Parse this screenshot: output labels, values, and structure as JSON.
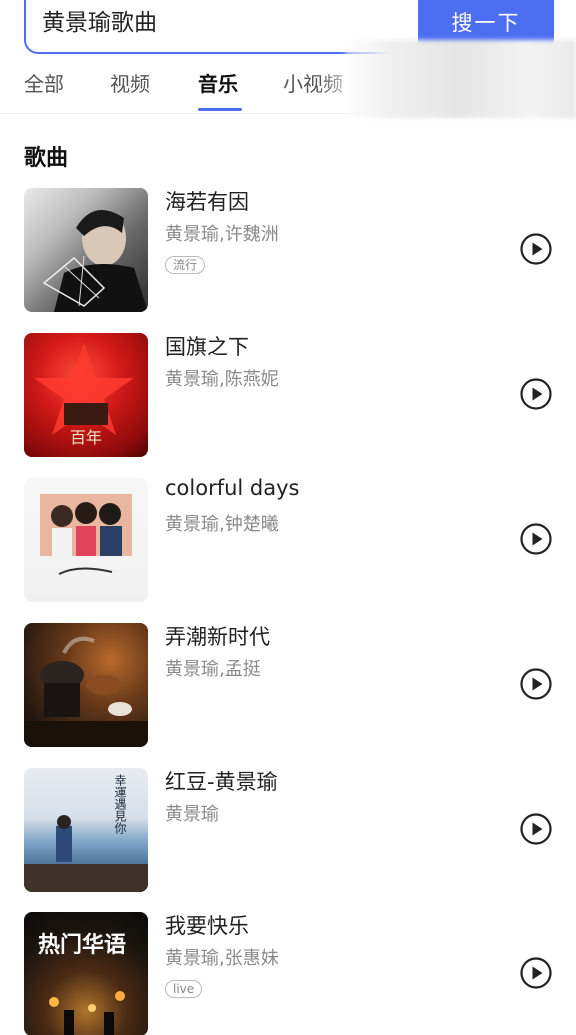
{
  "search": {
    "query": "黄景瑜歌曲",
    "button_label": "搜一下"
  },
  "tabs": [
    {
      "label": "全部",
      "active": false
    },
    {
      "label": "视频",
      "active": false
    },
    {
      "label": "音乐",
      "active": true
    },
    {
      "label": "小视频",
      "active": false
    }
  ],
  "section": {
    "title": "歌曲"
  },
  "songs": [
    {
      "title": "海若有因",
      "artist": "黄景瑜,许魏洲",
      "tag": "流行"
    },
    {
      "title": "国旗之下",
      "artist": "黄景瑜,陈燕妮",
      "tag": "",
      "cover_text": "百年"
    },
    {
      "title": "colorful days",
      "artist": "黄景瑜,钟楚曦",
      "tag": ""
    },
    {
      "title": "弄潮新时代",
      "artist": "黄景瑜,孟挺",
      "tag": ""
    },
    {
      "title": "红豆-黄景瑜",
      "artist": "黄景瑜",
      "tag": "",
      "cover_text": "幸運遇見你"
    },
    {
      "title": "我要快乐",
      "artist": "黄景瑜,张惠妹",
      "tag": "live",
      "cover_text": "热门华语"
    }
  ],
  "colors": {
    "accent": "#4e6ef2",
    "title": "#222222",
    "secondary": "#8a8a8a"
  },
  "icons": {
    "play": "play-circle-icon"
  }
}
